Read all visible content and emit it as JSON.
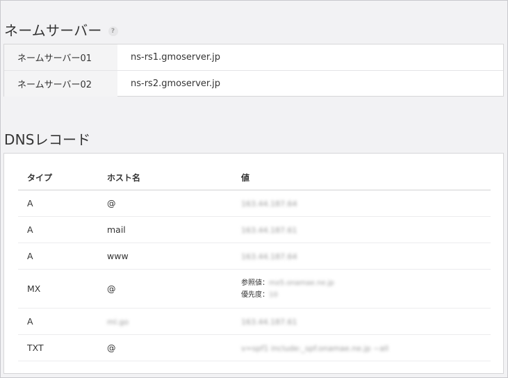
{
  "nameserver": {
    "title": "ネームサーバー",
    "help": "?",
    "rows": [
      {
        "label": "ネームサーバー01",
        "value": "ns-rs1.gmoserver.jp"
      },
      {
        "label": "ネームサーバー02",
        "value": "ns-rs2.gmoserver.jp"
      }
    ]
  },
  "dns": {
    "title": "DNSレコード",
    "headers": {
      "type": "タイプ",
      "host": "ホスト名",
      "value": "値"
    },
    "rows": [
      {
        "type": "A",
        "host": "@",
        "value": "163.44.187.64"
      },
      {
        "type": "A",
        "host": "mail",
        "value": "163.44.187.61"
      },
      {
        "type": "A",
        "host": "www",
        "value": "163.44.187.64"
      },
      {
        "type": "MX",
        "host": "@",
        "ref_label": "参照値：",
        "ref_value": "mx5.onamae.ne.jp",
        "pri_label": "優先度：",
        "pri_value": "10"
      },
      {
        "type": "A",
        "host": "ml.go",
        "value": "163.44.187.61"
      },
      {
        "type": "TXT",
        "host": "@",
        "value": "v=spf1 include:_spf.onamae.ne.jp ~all"
      }
    ]
  }
}
